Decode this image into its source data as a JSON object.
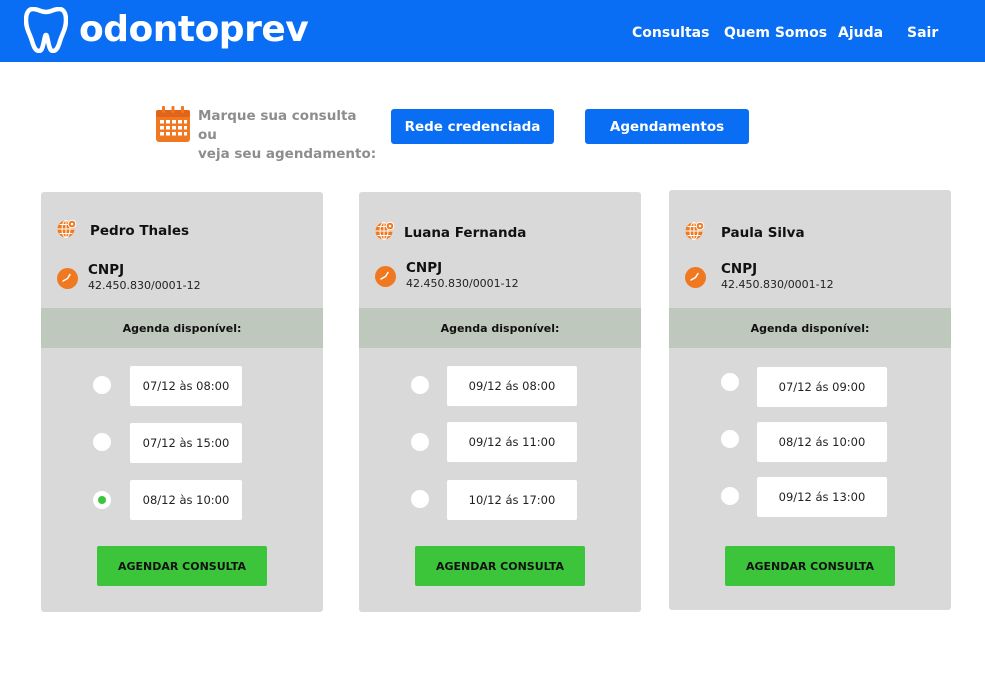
{
  "header": {
    "brand": "odontoprev",
    "logo_icon": "tooth-icon",
    "nav": [
      "Consultas",
      "Quem Somos",
      "Ajuda",
      "Sair"
    ]
  },
  "cta": {
    "icon": "calendar-icon",
    "text_line1": "Marque sua consulta ou",
    "text_line2": "veja seu agendamento:",
    "btn_rede": "Rede credenciada",
    "btn_agend": "Agendamentos"
  },
  "colors": {
    "brand_blue": "#0a6ef4",
    "accent_orange": "#f07820",
    "green": "#3cc43a",
    "card_bg": "#d9d9d9",
    "agenda_bar": "#bfc8bd"
  },
  "cards": [
    {
      "name": "Pedro Thales",
      "cnpj_label": "CNPJ",
      "cnpj_value": "42.450.830/0001-12",
      "agenda_label": "Agenda disponível:",
      "slots": [
        "07/12 às 08:00",
        "07/12 às 15:00",
        "08/12 às 10:00"
      ],
      "selected_slot": 2,
      "button": "AGENDAR CONSULTA"
    },
    {
      "name": "Luana Fernanda",
      "cnpj_label": "CNPJ",
      "cnpj_value": "42.450.830/0001-12",
      "agenda_label": "Agenda disponível:",
      "slots": [
        "09/12 ás 08:00",
        "09/12 ás 11:00",
        "10/12 ás 17:00"
      ],
      "selected_slot": null,
      "button": "AGENDAR CONSULTA"
    },
    {
      "name": "Paula Silva",
      "cnpj_label": "CNPJ",
      "cnpj_value": "42.450.830/0001-12",
      "agenda_label": "Agenda disponível:",
      "slots": [
        "07/12 ás 09:00",
        "08/12 ás 10:00",
        "09/12 ás 13:00"
      ],
      "selected_slot": null,
      "button": "AGENDAR CONSULTA"
    }
  ]
}
